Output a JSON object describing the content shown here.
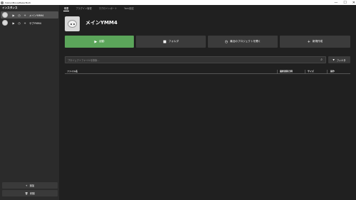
{
  "window": {
    "title": "YukkuriMovieMakerMulti",
    "controls": {
      "minimize": "—",
      "maximize": "☐",
      "close": "✕"
    }
  },
  "sidebar": {
    "header": "インスタンス",
    "instances": [
      {
        "label": "メインYMM4",
        "active": true
      },
      {
        "label": "サブYMM4",
        "active": false
      }
    ],
    "add_label": "追加",
    "delete_label": "削除"
  },
  "tabs": [
    {
      "label": "概要",
      "active": true
    },
    {
      "label": "プラグイン管理",
      "active": false
    },
    {
      "label": "マクロインポート",
      "active": false
    },
    {
      "label": "Yaml設定",
      "active": false
    }
  ],
  "instance_title": "メインYMM4",
  "actions": {
    "launch": "起動",
    "folder": "フォルダ",
    "recent_projects": "最近のプロジェクトを開く",
    "new_project": "新規作成"
  },
  "search": {
    "placeholder": "プロジェクトファイルを検索..."
  },
  "filter_label": "フィルタ",
  "table": {
    "columns": [
      "ファイル名",
      "最終更新日時",
      "サイズ",
      "操作"
    ]
  },
  "colors": {
    "accent": "#5ba55a",
    "background": "#202020",
    "sidebar": "#2b2b2b"
  }
}
